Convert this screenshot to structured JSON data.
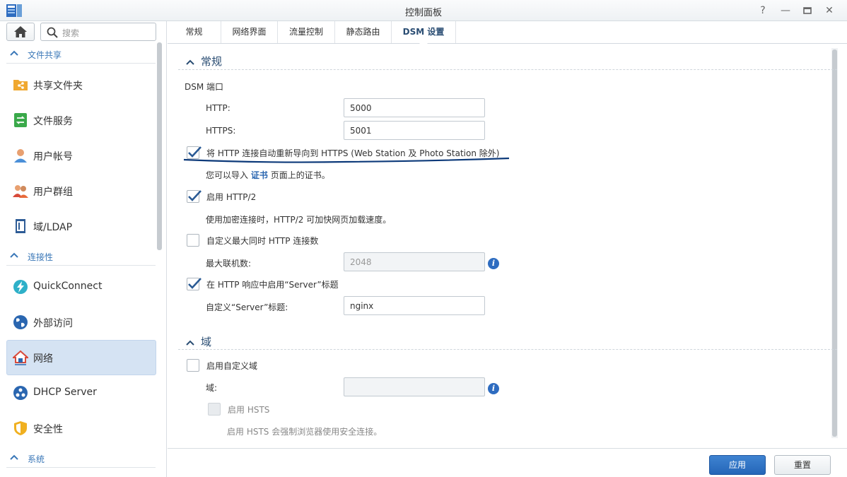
{
  "window": {
    "title": "控制面板"
  },
  "sidebar": {
    "search_placeholder": "搜索",
    "sections": [
      {
        "label": "文件共享",
        "items": [
          "共享文件夹",
          "文件服务",
          "用户帐号",
          "用户群组",
          "域/LDAP"
        ]
      },
      {
        "label": "连接性",
        "items": [
          "QuickConnect",
          "外部访问",
          "网络",
          "DHCP Server",
          "安全性"
        ]
      },
      {
        "label": "系统"
      }
    ],
    "active_item": "网络"
  },
  "tabs": [
    "常规",
    "网络界面",
    "流量控制",
    "静态路由",
    "DSM 设置"
  ],
  "active_tab": "DSM 设置",
  "general": {
    "heading": "常规",
    "dsm_port_label": "DSM 端口",
    "http_label": "HTTP:",
    "http_value": "5000",
    "https_label": "HTTPS:",
    "https_value": "5001",
    "redirect_label": "将 HTTP 连接自动重新导向到 HTTPS (Web Station 及 Photo Station 除外)",
    "redirect_checked": true,
    "cert_prefix": "您可以导入",
    "cert_link": "证书",
    "cert_suffix": "页面上的证书。",
    "http2_label": "启用 HTTP/2",
    "http2_checked": true,
    "http2_desc": "使用加密连接时，HTTP/2 可加快网页加载速度。",
    "custom_max_label": "自定义最大同时 HTTP 连接数",
    "custom_max_checked": false,
    "max_conn_label": "最大联机数:",
    "max_conn_value": "2048",
    "server_header_label": "在 HTTP 响应中启用“Server”标题",
    "server_header_checked": true,
    "custom_server_label": "自定义“Server”标题:",
    "custom_server_value": "nginx"
  },
  "domain": {
    "heading": "域",
    "enable_label": "启用自定义域",
    "enable_checked": false,
    "domain_label": "域:",
    "domain_value": "",
    "hsts_label": "启用 HSTS",
    "hsts_checked": false,
    "hsts_desc": "启用 HSTS 会强制浏览器使用安全连接。"
  },
  "footer": {
    "apply_label": "应用",
    "reset_label": "重置"
  },
  "colors": {
    "accent": "#2566b8",
    "heading": "#2a4d73",
    "active_nav": "#d5e3f3",
    "annotation": "#0d3a7a"
  }
}
